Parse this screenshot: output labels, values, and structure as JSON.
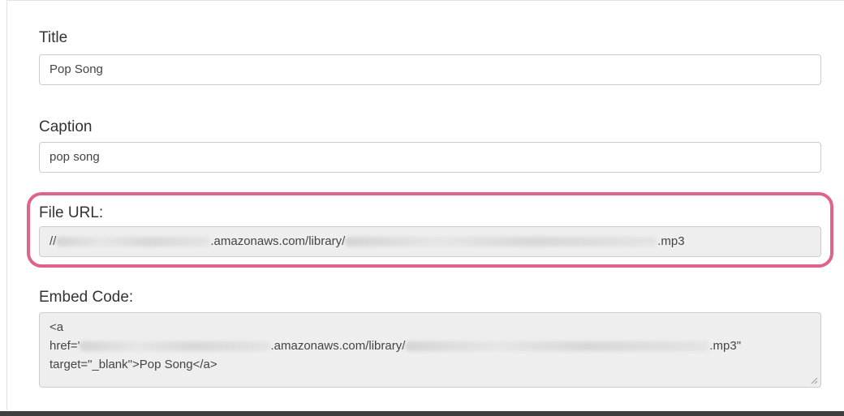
{
  "form": {
    "title": {
      "label": "Title",
      "value": "Pop Song"
    },
    "caption": {
      "label": "Caption",
      "value": "pop song"
    },
    "file_url": {
      "label": "File URL:",
      "prefix": "//",
      "domain": ".amazonaws.com/library/",
      "suffix": ".mp3"
    },
    "embed_code": {
      "label": "Embed Code:",
      "line1": "<a",
      "line2_prefix": "href='",
      "line2_domain": ".amazonaws.com/library/",
      "line2_suffix": ".mp3\"",
      "line3": "target=\"_blank\">Pop Song</a>"
    }
  },
  "colors": {
    "highlight": "#e0648a",
    "readonly_background": "#eeeeee"
  }
}
